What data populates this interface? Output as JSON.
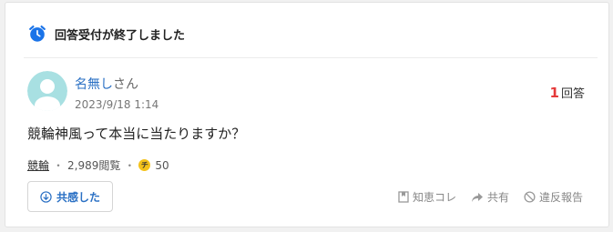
{
  "header": {
    "closed_notice": "回答受付が終了しました",
    "icon": "alarm-clock-icon",
    "accent_color": "#1a73e8"
  },
  "question": {
    "user_name": "名無し",
    "honorific": "さん",
    "posted_at": "2023/9/18 1:14",
    "answer_count": "1",
    "answer_label": "回答",
    "text": "競輪神風って本当に当たりますか？",
    "category": "競輪",
    "views": "2,989閲覧",
    "coin_symbol": "チ",
    "coins": "50"
  },
  "actions": {
    "empathy_label": "共感した",
    "bookmark_label": "知恵コレ",
    "share_label": "共有",
    "report_label": "違反報告"
  },
  "colors": {
    "link_blue": "#2a70c4",
    "answer_count_red": "#e53a3a",
    "coin_yellow": "#f4c21a"
  }
}
